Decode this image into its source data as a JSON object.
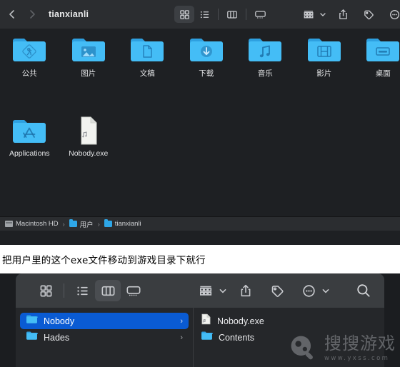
{
  "window1": {
    "title": "tianxianli",
    "nav": {
      "back": "back-arrow",
      "forward": "forward-arrow"
    },
    "toolbar": {
      "view_modes": [
        {
          "name": "icon-view",
          "icon": "grid-icon",
          "active": true
        },
        {
          "name": "list-view",
          "icon": "list-icon",
          "active": false
        },
        {
          "name": "column-view",
          "icon": "columns-icon",
          "active": false
        },
        {
          "name": "gallery-view",
          "icon": "gallery-icon",
          "active": false
        }
      ],
      "actions": [
        {
          "name": "group-by",
          "icon": "group-icon",
          "has_chevron": true
        },
        {
          "name": "share",
          "icon": "share-icon",
          "has_chevron": false
        },
        {
          "name": "tags",
          "icon": "tag-icon",
          "has_chevron": false
        },
        {
          "name": "more",
          "icon": "ellipsis-circle-icon",
          "has_chevron": true
        }
      ]
    },
    "items_row1": [
      {
        "label": "公共",
        "icon": "folder-public-icon",
        "glyph": "pedestrian"
      },
      {
        "label": "图片",
        "icon": "folder-pictures-icon",
        "glyph": "photo"
      },
      {
        "label": "文稿",
        "icon": "folder-documents-icon",
        "glyph": "document"
      },
      {
        "label": "下载",
        "icon": "folder-downloads-icon",
        "glyph": "download"
      },
      {
        "label": "音乐",
        "icon": "folder-music-icon",
        "glyph": "note"
      },
      {
        "label": "影片",
        "icon": "folder-movies-icon",
        "glyph": "film"
      },
      {
        "label": "桌面",
        "icon": "folder-desktop-icon",
        "glyph": "window"
      }
    ],
    "items_row2": [
      {
        "label": "Applications",
        "icon": "folder-applications-icon",
        "glyph": "appstore"
      },
      {
        "label": "Nobody.exe",
        "icon": "exe-file-icon",
        "glyph": "file"
      }
    ],
    "pathbar": [
      {
        "label": "Macintosh HD",
        "icon": "harddisk-icon"
      },
      {
        "label": "用户",
        "icon": "folder-icon"
      },
      {
        "label": "tianxianli",
        "icon": "folder-icon"
      }
    ],
    "path_separator": "›"
  },
  "caption": {
    "text": "把用户里的这个exe文件移动到游戏目录下就行"
  },
  "window2": {
    "toolbar": {
      "view_modes": [
        {
          "name": "icon-view",
          "icon": "grid-icon",
          "active": false
        },
        {
          "name": "list-view",
          "icon": "list-icon",
          "active": false
        },
        {
          "name": "column-view",
          "icon": "columns-icon",
          "active": true
        },
        {
          "name": "gallery-view",
          "icon": "gallery-icon",
          "active": false
        }
      ],
      "actions": [
        {
          "name": "group-by",
          "icon": "group-icon",
          "has_chevron": true
        },
        {
          "name": "share",
          "icon": "share-icon",
          "has_chevron": false
        },
        {
          "name": "tags",
          "icon": "tag-icon",
          "has_chevron": false
        },
        {
          "name": "more",
          "icon": "ellipsis-circle-icon",
          "has_chevron": true
        }
      ],
      "search": {
        "name": "search-icon"
      }
    },
    "column_left": [
      {
        "label": "Nobody",
        "type": "folder",
        "selected": true,
        "chevron": "›"
      },
      {
        "label": "Hades",
        "type": "folder",
        "selected": false,
        "chevron": "›"
      }
    ],
    "column_right": [
      {
        "label": "Nobody.exe",
        "type": "file",
        "selected": false,
        "chevron": ""
      },
      {
        "label": "Contents",
        "type": "folder",
        "selected": false,
        "chevron": ""
      }
    ]
  },
  "watermark": {
    "title": "搜搜游戏",
    "url": "www.yxss.com",
    "logo": "magnifier-logo"
  },
  "colors": {
    "accent_selection": "#0a5bd3",
    "folder_blue": "#35b5f2",
    "window1_bg": "#1e2023",
    "toolbar_bg": "#2b2d30",
    "window2_bg": "#25272a",
    "window2_toolbar_bg": "#3a3d40"
  }
}
